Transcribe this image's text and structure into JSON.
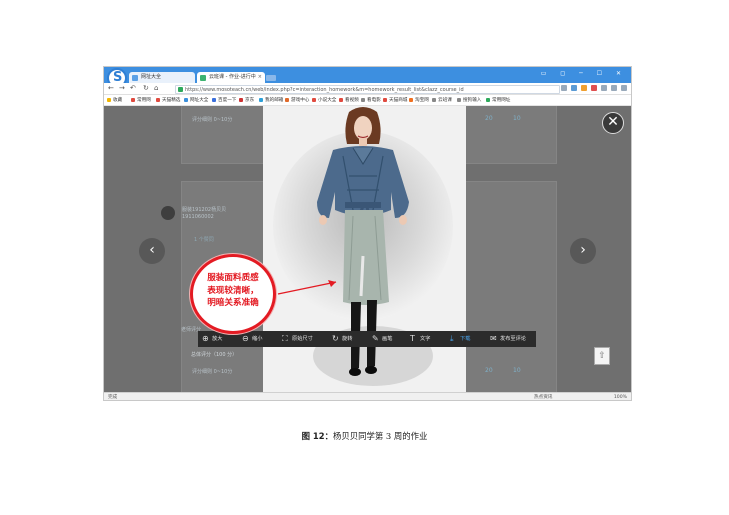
{
  "browser": {
    "tabs": [
      {
        "label": "网址大全"
      },
      {
        "label": "云班课 - 作业-进行中"
      }
    ],
    "url": "https://www.mosoteach.cn/web/index.php?c=interaction_homework&m=homework_result_list&clazz_course_id",
    "bookmarks": [
      "收藏",
      "常用网",
      "天猫精选",
      "网址大全",
      "百度一下",
      "京东",
      "我的邮箱",
      "游戏中心",
      "小说大全",
      "看视频",
      "看电影",
      "天猫商城",
      "淘宝网",
      "云班课",
      "搜狗输入",
      "常用网址"
    ],
    "status_left": "完成",
    "status_right": [
      "热点资讯",
      "100%"
    ]
  },
  "page": {
    "scores_top": [
      "20",
      "10"
    ],
    "scores_bottom": [
      "20",
      "10"
    ],
    "blur_title_top": "评分细则 0~10分",
    "student_name": "服装191202杨贝贝",
    "student_id": "1911060002",
    "like_line": "1 个赞同",
    "comment_label": "老师评分",
    "total_score": "总体评分（100 分）",
    "blur_title_bottom": "评分细则 0~10分"
  },
  "viewer": {
    "toolbar": [
      {
        "icon": "zoom-in-icon",
        "label": "放大"
      },
      {
        "icon": "zoom-out-icon",
        "label": "缩小"
      },
      {
        "icon": "original-size-icon",
        "label": "原始尺寸"
      },
      {
        "icon": "rotate-icon",
        "label": "旋转"
      },
      {
        "icon": "pen-icon",
        "label": "画笔"
      },
      {
        "icon": "text-icon",
        "label": "文字"
      },
      {
        "icon": "download-icon",
        "label": "下载"
      },
      {
        "icon": "publish-icon",
        "label": "发布至评论"
      }
    ],
    "active_tool": "下载"
  },
  "annotation": {
    "lines": [
      "服装面料质感",
      "表现较清晰，",
      "明暗关系准确"
    ],
    "color": "#e31b23"
  },
  "caption": {
    "prefix": "图 12：",
    "text": "杨贝贝同学第 3 周的作业"
  }
}
